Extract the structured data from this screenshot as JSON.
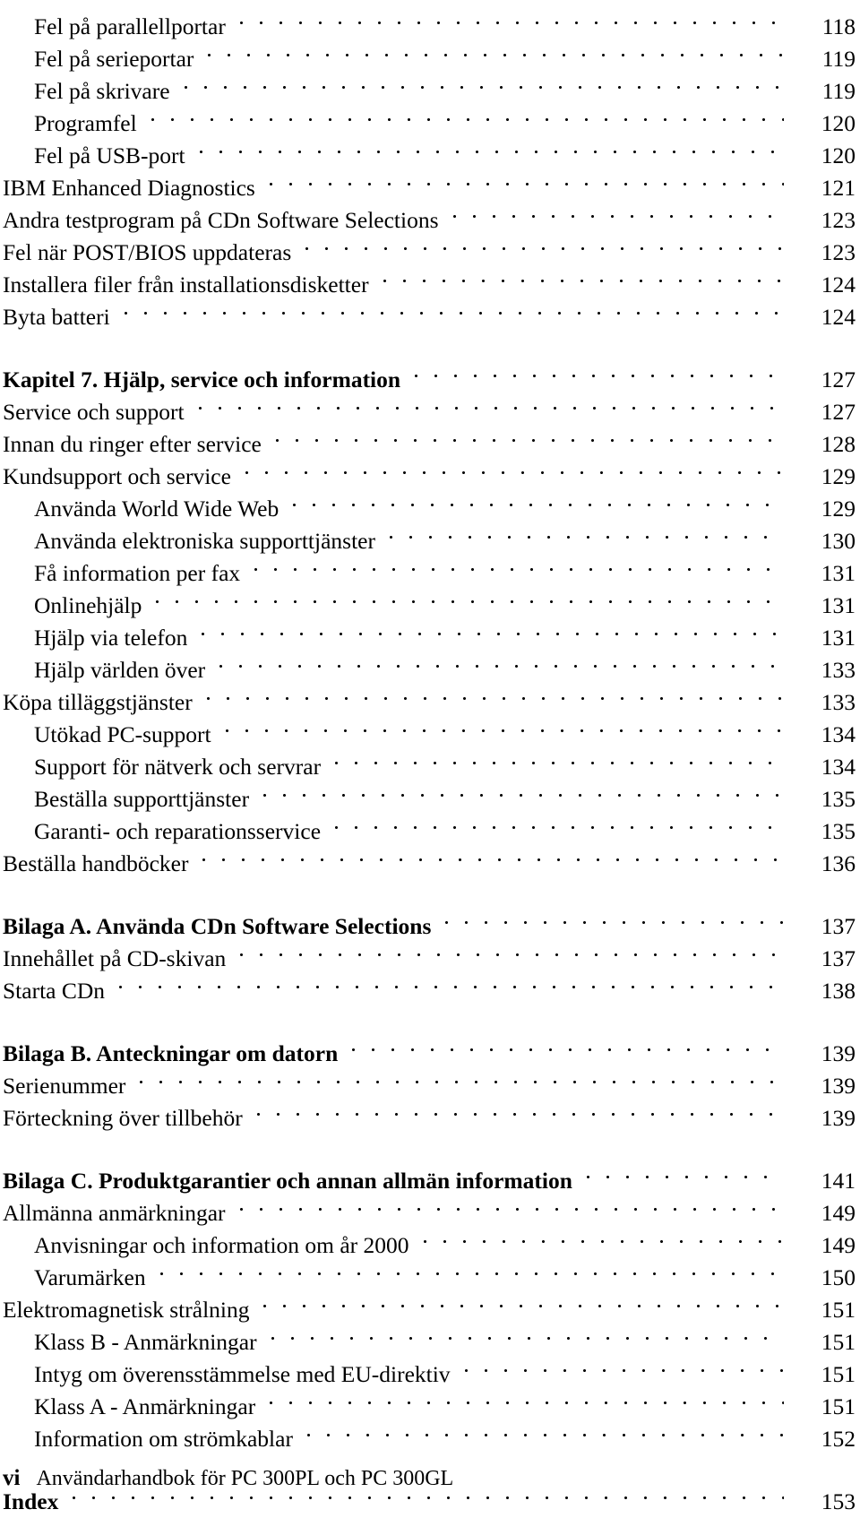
{
  "document": {
    "type": "table-of-contents",
    "language": "sv",
    "page_label": "vi",
    "book_title": "Användarhandbok för PC 300PL och PC 300GL"
  },
  "footer": {
    "folio": "vi",
    "book_title": "Användarhandbok för PC 300PL och PC 300GL"
  },
  "toc": {
    "entries": [
      {
        "title": "Fel på parallellportar",
        "page": "118",
        "level": 2,
        "heading": false,
        "gap_before": false
      },
      {
        "title": "Fel på serieportar",
        "page": "119",
        "level": 2,
        "heading": false,
        "gap_before": false
      },
      {
        "title": "Fel på skrivare",
        "page": "119",
        "level": 2,
        "heading": false,
        "gap_before": false
      },
      {
        "title": "Programfel",
        "page": "120",
        "level": 2,
        "heading": false,
        "gap_before": false
      },
      {
        "title": "Fel på USB-port",
        "page": "120",
        "level": 2,
        "heading": false,
        "gap_before": false
      },
      {
        "title": "IBM Enhanced Diagnostics",
        "page": "121",
        "level": 1,
        "heading": false,
        "gap_before": false
      },
      {
        "title": "Andra testprogram på CDn Software Selections",
        "page": "123",
        "level": 1,
        "heading": false,
        "gap_before": false
      },
      {
        "title": "Fel när POST/BIOS uppdateras",
        "page": "123",
        "level": 1,
        "heading": false,
        "gap_before": false
      },
      {
        "title": "Installera filer från installationsdisketter",
        "page": "124",
        "level": 1,
        "heading": false,
        "gap_before": false
      },
      {
        "title": "Byta batteri",
        "page": "124",
        "level": 1,
        "heading": false,
        "gap_before": false
      },
      {
        "title": "Kapitel 7.  Hjälp, service och information",
        "page": "127",
        "level": 1,
        "heading": true,
        "gap_before": true
      },
      {
        "title": "Service och support",
        "page": "127",
        "level": 1,
        "heading": false,
        "gap_before": false
      },
      {
        "title": "Innan du ringer efter service",
        "page": "128",
        "level": 1,
        "heading": false,
        "gap_before": false
      },
      {
        "title": "Kundsupport och service",
        "page": "129",
        "level": 1,
        "heading": false,
        "gap_before": false
      },
      {
        "title": "Använda World Wide Web",
        "page": "129",
        "level": 2,
        "heading": false,
        "gap_before": false
      },
      {
        "title": "Använda elektroniska supporttjänster",
        "page": "130",
        "level": 2,
        "heading": false,
        "gap_before": false
      },
      {
        "title": "Få information per fax",
        "page": "131",
        "level": 2,
        "heading": false,
        "gap_before": false
      },
      {
        "title": "Onlinehjälp",
        "page": "131",
        "level": 2,
        "heading": false,
        "gap_before": false
      },
      {
        "title": "Hjälp via telefon",
        "page": "131",
        "level": 2,
        "heading": false,
        "gap_before": false
      },
      {
        "title": "Hjälp världen över",
        "page": "133",
        "level": 2,
        "heading": false,
        "gap_before": false
      },
      {
        "title": "Köpa tilläggstjänster",
        "page": "133",
        "level": 1,
        "heading": false,
        "gap_before": false
      },
      {
        "title": "Utökad PC-support",
        "page": "134",
        "level": 2,
        "heading": false,
        "gap_before": false
      },
      {
        "title": "Support för nätverk och servrar",
        "page": "134",
        "level": 2,
        "heading": false,
        "gap_before": false
      },
      {
        "title": "Beställa supporttjänster",
        "page": "135",
        "level": 2,
        "heading": false,
        "gap_before": false
      },
      {
        "title": "Garanti- och reparationsservice",
        "page": "135",
        "level": 2,
        "heading": false,
        "gap_before": false
      },
      {
        "title": "Beställa handböcker",
        "page": "136",
        "level": 1,
        "heading": false,
        "gap_before": false
      },
      {
        "title": "Bilaga A.  Använda CDn Software Selections",
        "page": "137",
        "level": 1,
        "heading": true,
        "gap_before": true
      },
      {
        "title": "Innehållet på CD-skivan",
        "page": "137",
        "level": 1,
        "heading": false,
        "gap_before": false
      },
      {
        "title": "Starta CDn",
        "page": "138",
        "level": 1,
        "heading": false,
        "gap_before": false
      },
      {
        "title": "Bilaga B.  Anteckningar om datorn",
        "page": "139",
        "level": 1,
        "heading": true,
        "gap_before": true
      },
      {
        "title": "Serienummer",
        "page": "139",
        "level": 1,
        "heading": false,
        "gap_before": false
      },
      {
        "title": "Förteckning över tillbehör",
        "page": "139",
        "level": 1,
        "heading": false,
        "gap_before": false
      },
      {
        "title": "Bilaga C.  Produktgarantier och annan allmän information",
        "page": "141",
        "level": 1,
        "heading": true,
        "gap_before": true
      },
      {
        "title": "Allmänna anmärkningar",
        "page": "149",
        "level": 1,
        "heading": false,
        "gap_before": false
      },
      {
        "title": "Anvisningar och information om år 2000",
        "page": "149",
        "level": 2,
        "heading": false,
        "gap_before": false
      },
      {
        "title": "Varumärken",
        "page": "150",
        "level": 2,
        "heading": false,
        "gap_before": false
      },
      {
        "title": "Elektromagnetisk strålning",
        "page": "151",
        "level": 1,
        "heading": false,
        "gap_before": false
      },
      {
        "title": "Klass B - Anmärkningar",
        "page": "151",
        "level": 2,
        "heading": false,
        "gap_before": false
      },
      {
        "title": "Intyg om överensstämmelse med EU-direktiv",
        "page": "151",
        "level": 2,
        "heading": false,
        "gap_before": false
      },
      {
        "title": "Klass A - Anmärkningar",
        "page": "151",
        "level": 2,
        "heading": false,
        "gap_before": false
      },
      {
        "title": "Information om strömkablar",
        "page": "152",
        "level": 2,
        "heading": false,
        "gap_before": false
      },
      {
        "title": "Index",
        "page": "153",
        "level": 1,
        "heading": true,
        "gap_before": true
      }
    ]
  }
}
